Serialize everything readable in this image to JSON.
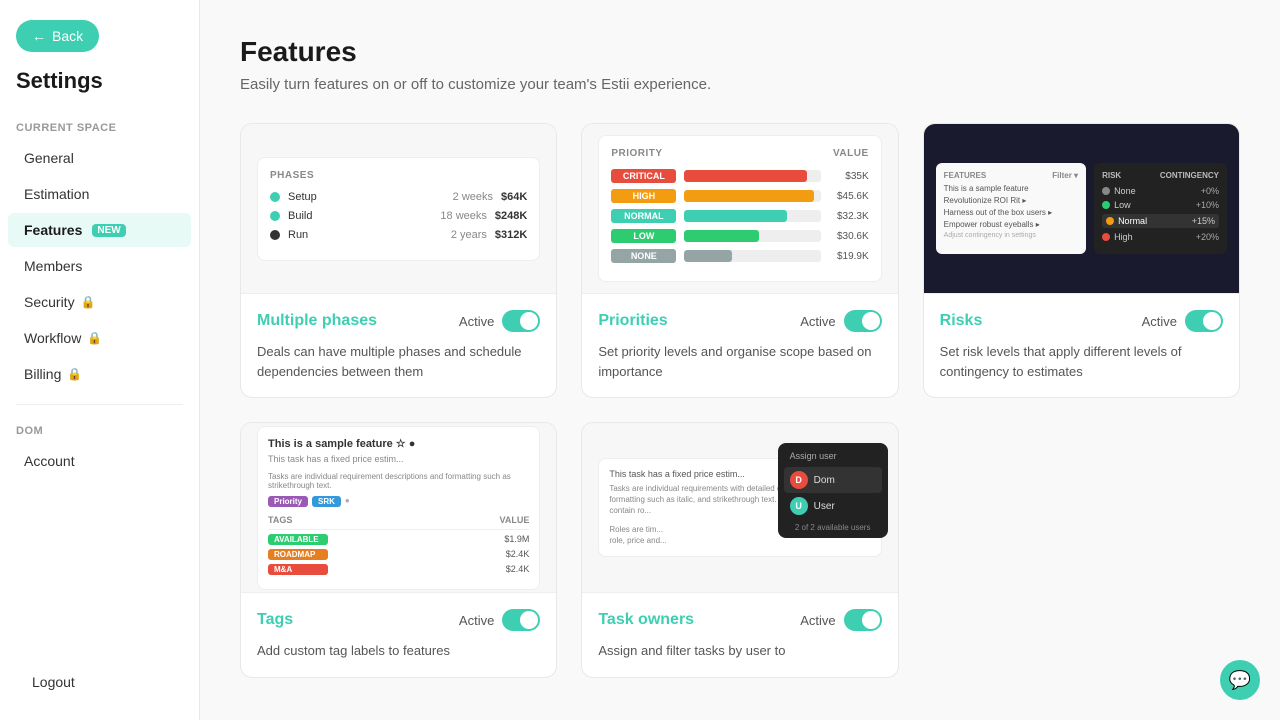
{
  "sidebar": {
    "back_label": "Back",
    "title": "Settings",
    "section_current_space": "CURRENT SPACE",
    "items_current": [
      {
        "id": "general",
        "label": "General",
        "lock": false,
        "active": false
      },
      {
        "id": "estimation",
        "label": "Estimation",
        "lock": false,
        "active": false
      },
      {
        "id": "features",
        "label": "Features",
        "lock": false,
        "active": true,
        "badge": "NEW"
      },
      {
        "id": "members",
        "label": "Members",
        "lock": false,
        "active": false
      },
      {
        "id": "security",
        "label": "Security",
        "lock": true,
        "active": false
      },
      {
        "id": "workflow",
        "label": "Workflow",
        "lock": true,
        "active": false
      },
      {
        "id": "billing",
        "label": "Billing",
        "lock": true,
        "active": false
      }
    ],
    "section_dom": "DOM",
    "items_dom": [
      {
        "id": "account",
        "label": "Account",
        "lock": false,
        "active": false
      }
    ],
    "logout_label": "Logout"
  },
  "main": {
    "title": "Features",
    "subtitle": "Easily turn features on or off to customize your team's Estii experience.",
    "cards": [
      {
        "id": "multiple-phases",
        "title": "Multiple phases",
        "status": "Active",
        "enabled": true,
        "description": "Deals can have multiple phases and schedule dependencies between them"
      },
      {
        "id": "priorities",
        "title": "Priorities",
        "status": "Active",
        "enabled": true,
        "description": "Set priority levels and organise scope based on importance"
      },
      {
        "id": "risks",
        "title": "Risks",
        "status": "Active",
        "enabled": true,
        "description": "Set risk levels that apply different levels of contingency to estimates"
      },
      {
        "id": "tags",
        "title": "Tags",
        "status": "Active",
        "enabled": true,
        "description": "Add custom tag labels to features"
      },
      {
        "id": "task-owners",
        "title": "Task owners",
        "status": "Active",
        "enabled": true,
        "description": "Assign and filter tasks by user to"
      }
    ]
  }
}
